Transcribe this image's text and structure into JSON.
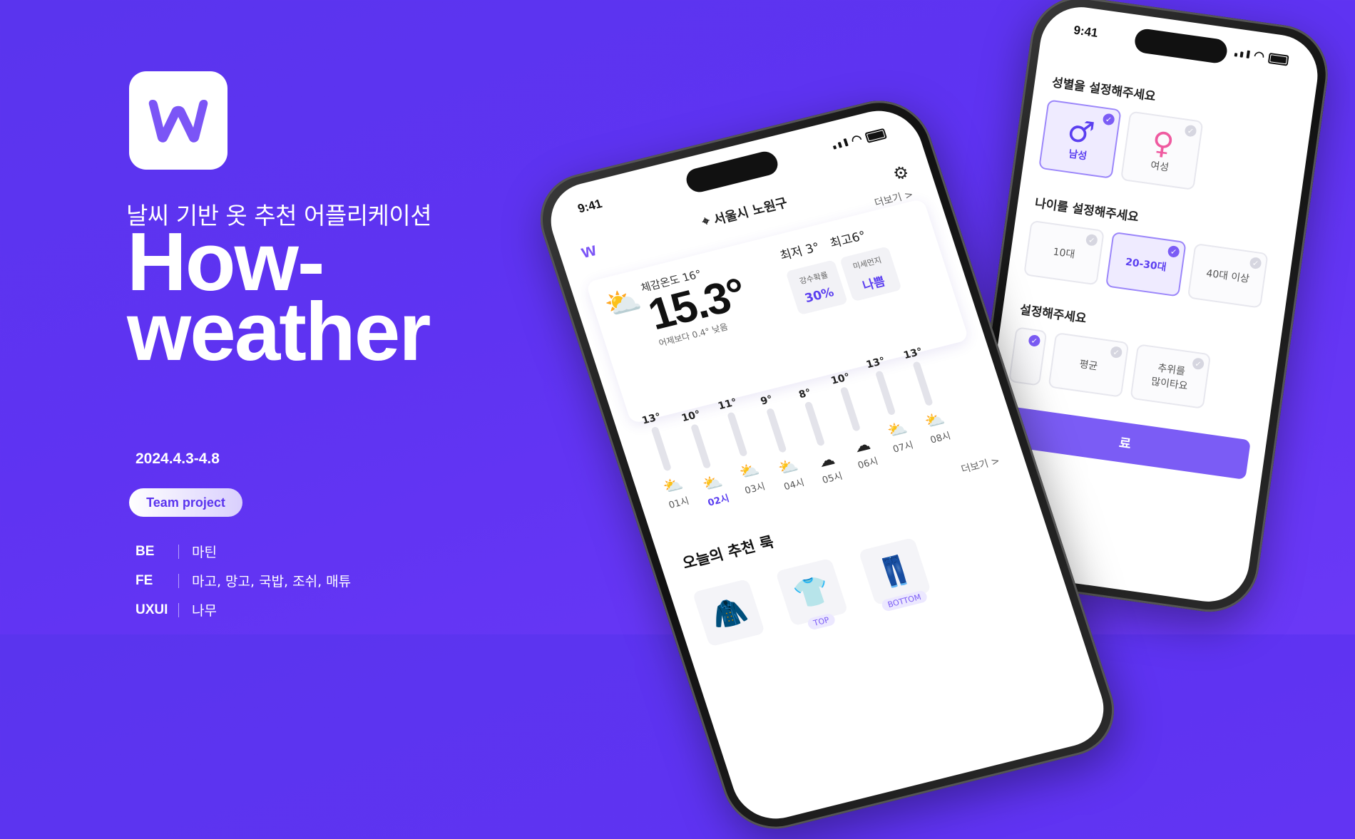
{
  "hero": {
    "subtitle": "날씨 기반 옷 추천 어플리케이션",
    "title_line1": "How-",
    "title_line2": "weather",
    "date": "2024.4.3-4.8",
    "badge": "Team project",
    "team": [
      {
        "role": "BE",
        "names": "마틴"
      },
      {
        "role": "FE",
        "names": "마고, 망고, 국밥, 조쉬, 매튜"
      },
      {
        "role": "UXUI",
        "names": "나무"
      }
    ]
  },
  "colors": {
    "brand": "#5f33f2",
    "accent": "#7b5cf5"
  },
  "back_phone": {
    "time": "9:41",
    "gender_title": "성별을 설정해주세요",
    "gender_options": [
      "남성",
      "여성"
    ],
    "age_title": "나이를 설정해주세요",
    "age_options": [
      "10대",
      "20-30대",
      "40대 이상"
    ],
    "cold_title": "설정해주세요",
    "cold_options": [
      "평균",
      "추위를\n많이타요"
    ],
    "done_label": "료"
  },
  "front_phone": {
    "time": "9:41",
    "location": "서울시 노원구",
    "more_label": "더보기 >",
    "feels_like": "체감온도 16°",
    "temperature": "15.3°",
    "compare": "어제보다 0.4° 낮음",
    "min": "최저 3°",
    "max": "최고6°",
    "precip_label": "강수확률",
    "precip_value": "30%",
    "dust_label": "미세먼지",
    "dust_value": "나쁨",
    "hourly": [
      {
        "temp": "13°",
        "hour": "01시"
      },
      {
        "temp": "10°",
        "hour": "02시"
      },
      {
        "temp": "11°",
        "hour": "03시"
      },
      {
        "temp": "9°",
        "hour": "04시"
      },
      {
        "temp": "8°",
        "hour": "05시"
      },
      {
        "temp": "10°",
        "hour": "06시"
      },
      {
        "temp": "13°",
        "hour": "07시"
      },
      {
        "temp": "13°",
        "hour": "08시"
      }
    ],
    "rec_title": "오늘의 추천 룩",
    "rec_more": "더보기 >",
    "items": [
      "",
      "TOP",
      "BOTTOM"
    ]
  }
}
